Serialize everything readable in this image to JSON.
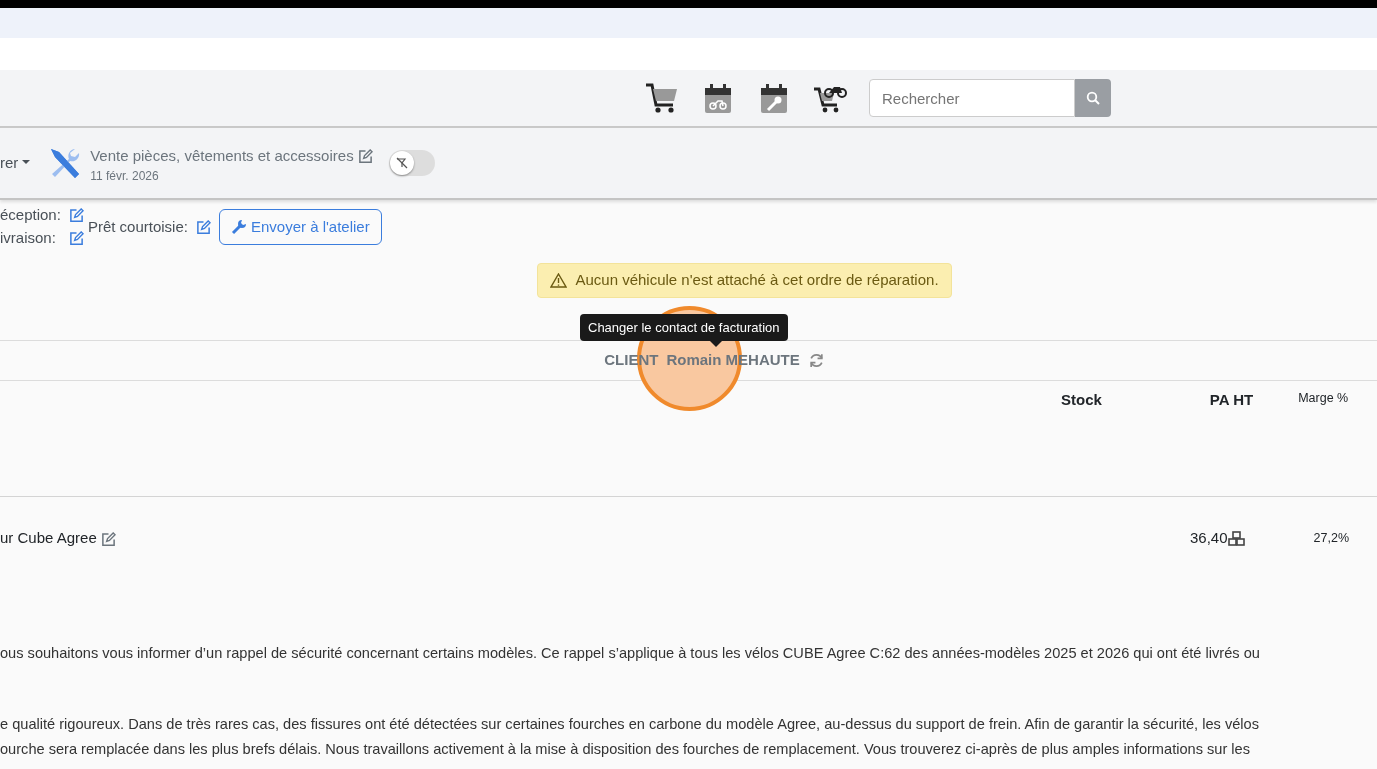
{
  "navbar": {
    "search": {
      "placeholder": "Rechercher"
    }
  },
  "toolbar": {
    "dropdown": "rer",
    "title": "Vente pièces, vêtements et accessoires",
    "date": "11 févr. 2026",
    "toggle": {
      "on": false
    }
  },
  "fields": [
    {
      "label": "éception:"
    },
    {
      "label": "ivraison:"
    }
  ],
  "loan": {
    "label": "Prêt courtoisie:"
  },
  "send_button": "Envoyer à l'atelier",
  "alert": "Aucun véhicule n'est attaché à cet ordre de réparation.",
  "tooltip": "Changer le contact de facturation",
  "client": {
    "label": "CLIENT",
    "name": "Romain MEHAUTE"
  },
  "table": {
    "columns": [
      "Stock",
      "PA HT",
      "Marge %"
    ],
    "rows": [
      {
        "designation": "ur Cube Agree",
        "stock": "",
        "pa_ht": "36,40",
        "marge": "27,2%"
      }
    ]
  },
  "notes": [
    "ous souhaitons vous informer d’un rappel de sécurité concernant certains modèles. Ce rappel s’applique à tous les vélos CUBE Agree C:62 des années-modèles 2025 et 2026 qui ont été livrés ou",
    "e qualité rigoureux. Dans de très rares cas, des fissures ont été détectées sur certaines fourches en carbone du modèle Agree, au-dessus du support de frein. Afin de garantir la sécurité, les vélos",
    "ourche sera remplacée dans les plus brefs délais. Nous travaillons activement à la mise à disposition des fourches de remplacement. Vous trouverez ci-après de plus amples informations sur les"
  ]
}
